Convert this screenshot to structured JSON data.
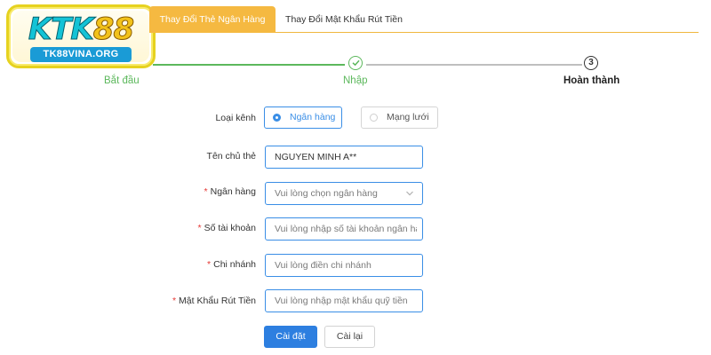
{
  "logo": {
    "main_text_a": "KTK",
    "main_text_b": "88",
    "sub_text": "TK88VINA.ORG"
  },
  "tabs": [
    {
      "label": "Thay Đổi Thẻ Ngân Hàng",
      "active": true
    },
    {
      "label": "Thay Đổi Mật Khẩu Rút Tiền",
      "active": false
    }
  ],
  "steps": [
    {
      "label": "Bắt đầu",
      "state": "done"
    },
    {
      "label": "Nhập",
      "state": "current",
      "icon": "check-icon"
    },
    {
      "label": "Hoàn thành",
      "state": "pending",
      "number": "3"
    }
  ],
  "form": {
    "channel": {
      "label": "Loại kênh",
      "options": [
        "Ngân hàng",
        "Mạng lưới"
      ],
      "selected": "Ngân hàng"
    },
    "holder": {
      "label": "Tên chủ thẻ",
      "value": "NGUYEN MINH A**"
    },
    "bank": {
      "label": "Ngân hàng",
      "required": true,
      "placeholder": "Vui lòng chọn ngân hàng"
    },
    "account": {
      "label": "Số tài khoản",
      "required": true,
      "placeholder": "Vui lòng nhập số tài khoản ngân hà"
    },
    "branch": {
      "label": "Chi nhánh",
      "required": true,
      "placeholder": "Vui lòng điền chi nhánh"
    },
    "password": {
      "label": "Mật Khẩu Rút Tiền",
      "required": true,
      "placeholder": "Vui lòng nhập mật khẩu quỹ tiền"
    },
    "required_mark": "*",
    "submit_label": "Cài đặt",
    "reset_label": "Cài lại"
  },
  "colors": {
    "accent": "#f5b941",
    "primary": "#2d7fe0",
    "success": "#5cb85c",
    "required": "#e53935"
  }
}
